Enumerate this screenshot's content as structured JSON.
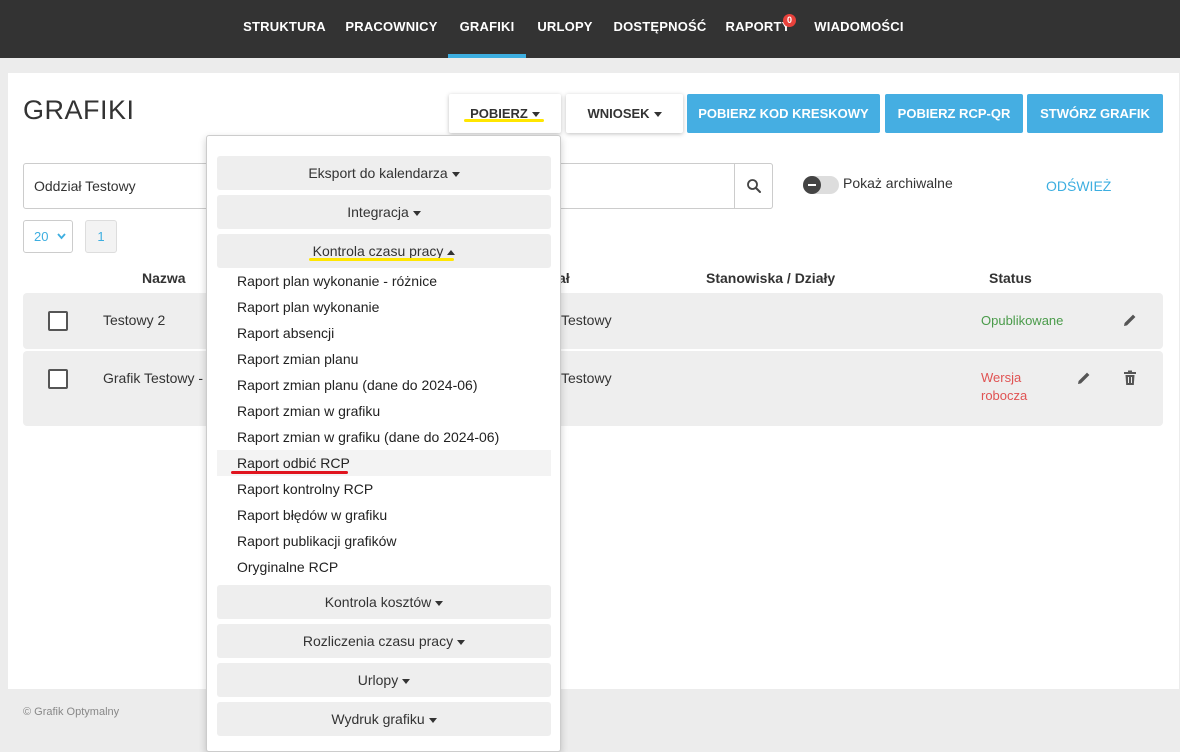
{
  "nav": {
    "items": [
      {
        "label": "STRUKTURA"
      },
      {
        "label": "PRACOWNICY"
      },
      {
        "label": "GRAFIKI"
      },
      {
        "label": "URLOPY"
      },
      {
        "label": "DOSTĘPNOŚĆ"
      },
      {
        "label": "RAPORTY",
        "badge": "0"
      },
      {
        "label": "WIADOMOŚCI"
      }
    ],
    "active": "GRAFIKI",
    "accent": "#3daee0"
  },
  "page": {
    "title": "GRAFIKI",
    "buttons": {
      "pobierz": "POBIERZ",
      "wniosek": "WNIOSEK",
      "kod_kreskowy": "POBIERZ KOD KRESKOWY",
      "rcp_qr": "POBIERZ RCP-QR",
      "stworz": "STWÓRZ GRAFIK"
    },
    "filter_value": "Oddział Testowy",
    "show_archived_label": "Pokaż archiwalne",
    "refresh_label": "ODŚWIEŻ",
    "per_page": "20",
    "current_page": "1"
  },
  "table": {
    "headers": {
      "name": "Nazwa",
      "unit": "ał",
      "positions": "Stanowiska / Działy",
      "status": "Status"
    },
    "rows": [
      {
        "name": "Testowy 2",
        "unit": "Testowy",
        "status": "Opublikowane"
      },
      {
        "name": "Grafik Testowy - S",
        "unit": "Testowy",
        "status_line1": "Wersja",
        "status_line2": "robocza"
      }
    ]
  },
  "dropdown": {
    "sections_top": [
      "Eksport do kalendarza",
      "Integracja",
      "Kontrola czasu pracy"
    ],
    "items": [
      "Raport plan wykonanie - różnice",
      "Raport plan wykonanie",
      "Raport absencji",
      "Raport zmian planu",
      "Raport zmian planu (dane do 2024-06)",
      "Raport zmian w grafiku",
      "Raport zmian w grafiku (dane do 2024-06)",
      "Raport odbić RCP",
      "Raport kontrolny RCP",
      "Raport błędów w grafiku",
      "Raport publikacji grafików",
      "Oryginalne RCP"
    ],
    "sections_bottom": [
      "Kontrola kosztów",
      "Rozliczenia czasu pracy",
      "Urlopy",
      "Wydruk grafiku"
    ]
  },
  "footer": {
    "text": "© Grafik Optymalny"
  },
  "colors": {
    "primary": "#45aee2",
    "highlight_yellow": "#ffe600",
    "highlight_red": "#e0141e",
    "published": "#4a9b4a",
    "draft": "#e05353"
  }
}
